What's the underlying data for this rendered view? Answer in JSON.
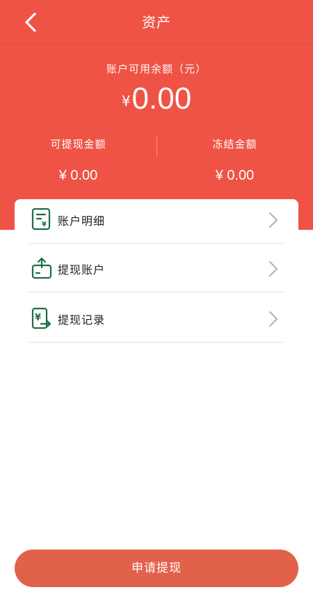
{
  "nav": {
    "title": "资产",
    "back_icon": "chevron-left-icon"
  },
  "balance": {
    "label": "账户可用余额（元）",
    "currency": "¥",
    "amount": "0.00"
  },
  "stats": [
    {
      "label": "可提现金额",
      "value": "¥ 0.00"
    },
    {
      "label": "冻结金额",
      "value": "¥ 0.00"
    }
  ],
  "menu": [
    {
      "label": "账户明细",
      "icon": "bill-detail-icon"
    },
    {
      "label": "提现账户",
      "icon": "wallet-upload-icon"
    },
    {
      "label": "提现记录",
      "icon": "withdraw-record-icon"
    }
  ],
  "submit": {
    "label": "申请提现"
  },
  "colors": {
    "primary": "#ef5346",
    "button": "#e2614a",
    "icon": "#1f6b43"
  }
}
